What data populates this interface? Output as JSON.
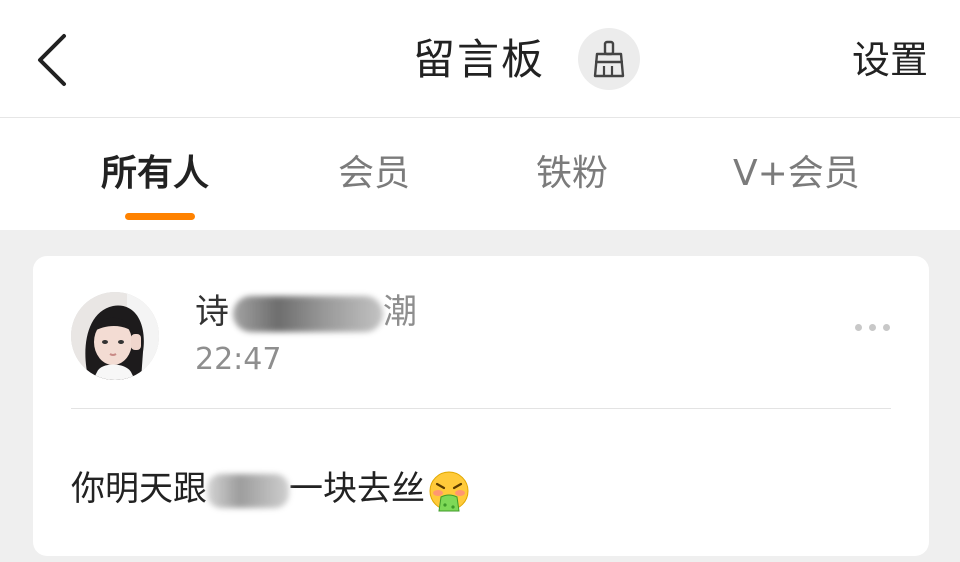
{
  "header": {
    "title": "留言板",
    "settings_label": "设置",
    "back_icon": "chevron-left-icon",
    "clear_icon": "broom-icon"
  },
  "tabs": [
    {
      "label": "所有人",
      "active": true
    },
    {
      "label": "会员",
      "active": false
    },
    {
      "label": "铁粉",
      "active": false
    },
    {
      "label": "V+会员",
      "active": false
    }
  ],
  "accent_color": "#ff8200",
  "message": {
    "username_visible": "诗",
    "username_tail": "潮",
    "time": "22:47",
    "text_prefix": "你明天跟",
    "text_suffix": "一块去丝",
    "emoji": "vomiting-face-emoji"
  }
}
